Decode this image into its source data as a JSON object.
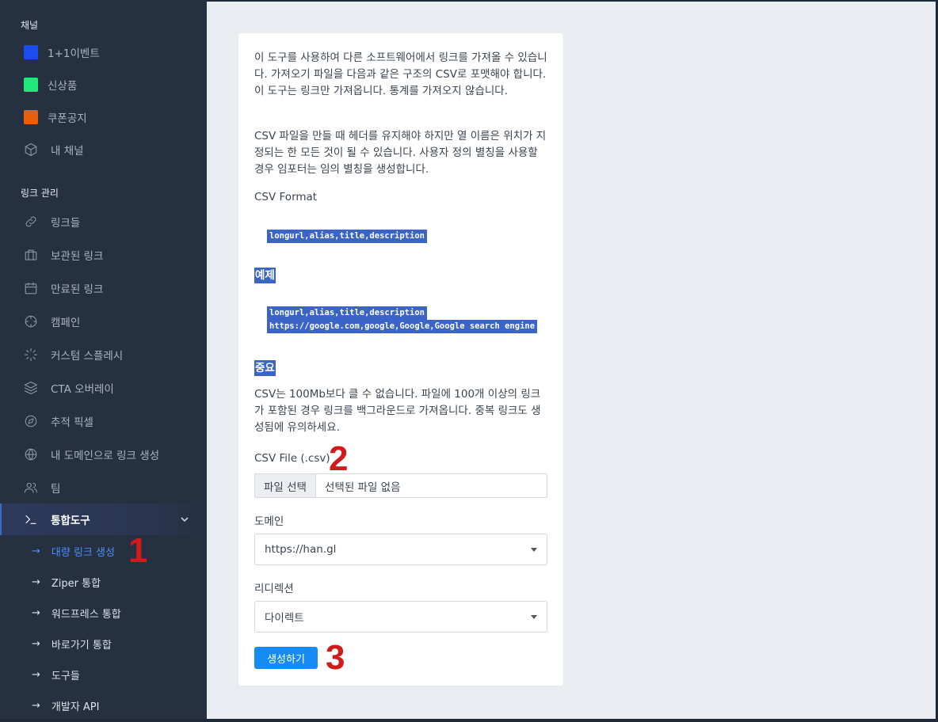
{
  "sidebar": {
    "channels_title": "채널",
    "channels": [
      {
        "label": "1+1이벤트",
        "color": "#1a4cf0"
      },
      {
        "label": "신상품",
        "color": "#1fe87a"
      },
      {
        "label": "쿠폰공지",
        "color": "#e8600f"
      },
      {
        "label": "내 채널",
        "icon": "box-icon"
      }
    ],
    "links_title": "링크 관리",
    "items": [
      {
        "label": "링크들",
        "icon": "link-icon"
      },
      {
        "label": "보관된 링크",
        "icon": "briefcase-icon"
      },
      {
        "label": "만료된 링크",
        "icon": "calendar-icon"
      },
      {
        "label": "캠페인",
        "icon": "crosshair-icon"
      },
      {
        "label": "커스텀 스플레시",
        "icon": "loader-icon"
      },
      {
        "label": "CTA 오버레이",
        "icon": "layers-icon"
      },
      {
        "label": "추적 픽셀",
        "icon": "compass-icon"
      },
      {
        "label": "내 도메인으로 링크 생성",
        "icon": "globe-icon"
      },
      {
        "label": "팀",
        "icon": "users-icon"
      },
      {
        "label": "통합도구",
        "icon": "terminal-icon",
        "expanded": true
      }
    ],
    "sub_items": [
      {
        "label": "대량 링크 생성",
        "current": true
      },
      {
        "label": "Ziper 통합"
      },
      {
        "label": "워드프레스 통합"
      },
      {
        "label": "바로가기 통합"
      },
      {
        "label": "도구들"
      },
      {
        "label": "개발자 API"
      }
    ],
    "arrow": "→"
  },
  "card": {
    "intro": "이 도구를 사용하여 다른 소프트웨어에서 링크를 가져올 수 있습니다. 가져오기 파일을 다음과 같은 구조의 CSV로 포맷해야 합니다. 이 도구는 링크만 가져옵니다. 통계를 가져오지 않습니다.",
    "csv_note": "CSV 파일을 만들 때 헤더를 유지해야 하지만 열 이름은 위치가 지정되는 한 모든 것이 될 수 있습니다. 사용자 정의 별칭을 사용할 경우 임포터는 임의 별칭을 생성합니다.",
    "format_label": "CSV Format",
    "format_code": "longurl,alias,title,description",
    "example_title": "예제",
    "example_line1": "longurl,alias,title,description",
    "example_line2": "https://google.com,google,Google,Google search engine",
    "important_title": "중요",
    "important_text": "CSV는 100Mb보다 클 수 없습니다. 파일에 100개 이상의 링크가 포함된 경우 링크를 백그라운드로 가져옵니다. 중복 링크도 생성됨에 유의하세요.",
    "file_label": "CSV File (.csv)",
    "file_button": "파일 선택",
    "file_status": "선택된 파일 없음",
    "domain_label": "도메인",
    "domain_value": "https://han.gl",
    "redirect_label": "리디렉션",
    "redirect_value": "다이렉트",
    "submit_label": "생성하기"
  },
  "annotations": {
    "one": "1",
    "two": "2",
    "three": "3",
    "color": "#d11b1b"
  }
}
